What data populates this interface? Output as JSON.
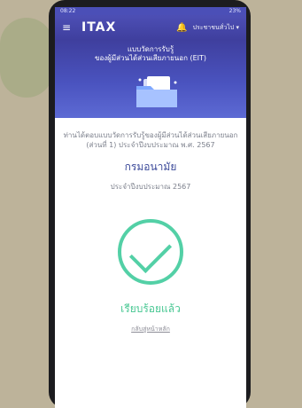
{
  "status": {
    "time": "08:22",
    "right": "23%"
  },
  "topbar": {
    "logo": "ITAX",
    "user": "ประชาชนทั่วไป ▾"
  },
  "hero": {
    "line1": "แบบวัดการรับรู้",
    "line2": "ของผู้มีส่วนได้ส่วนเสียภายนอก (EIT)"
  },
  "content": {
    "desc": "ท่านได้ตอบแบบวัดการรับรู้ของผู้มีส่วนได้ส่วนเสียภายนอก (ส่วนที่ 1) ประจำปีงบประมาณ พ.ศ. 2567",
    "org": "กรมอนามัย",
    "year": "ประจำปีงบประมาณ 2567",
    "done": "เรียบร้อยแล้ว",
    "back": "กลับสู่หน้าหลัก"
  }
}
